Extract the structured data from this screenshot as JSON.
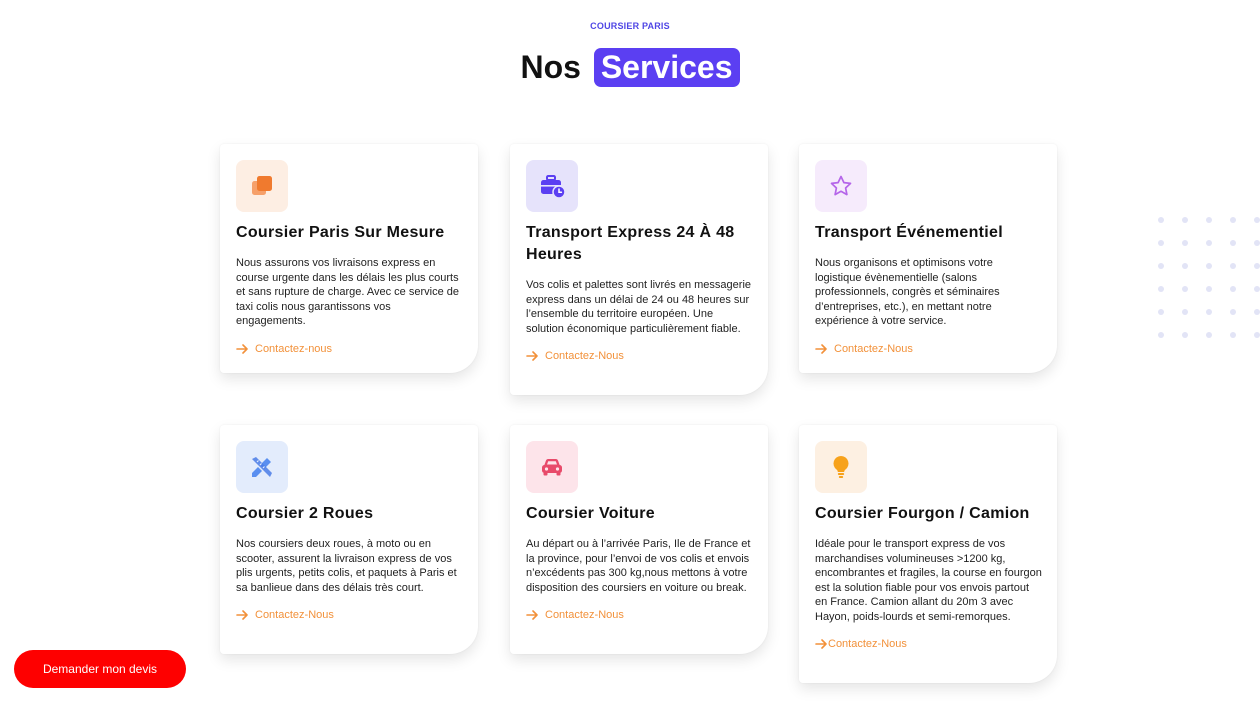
{
  "header": {
    "eyebrow": "COURSIER PARIS",
    "title_plain": "Nos",
    "title_highlight": "Services"
  },
  "colors": {
    "accent": "#5b3ff2",
    "link": "#f2913a",
    "cta_button": "#fe0000"
  },
  "services": [
    {
      "icon": "copy-icon",
      "title": "Coursier Paris Sur Mesure",
      "description": "Nous assurons vos livraisons express en course urgente dans les délais les plus courts et sans rupture de charge. Avec ce service de taxi colis nous garantissons vos engagements.",
      "link": "Contactez-nous"
    },
    {
      "icon": "briefcase-clock-icon",
      "title": "Transport Express 24 À 48 Heures",
      "description": "Vos colis et palettes sont livrés en messagerie express dans un délai de 24 ou 48 heures sur l’ensemble du territoire européen. Une solution économique particulièrement fiable.",
      "link": "Contactez-Nous"
    },
    {
      "icon": "star-icon",
      "title": "Transport Événementiel",
      "description": "Nous organisons et optimisons votre logistique évènementielle (salons professionnels, congrès et séminaires d’entreprises, etc.), en mettant notre expérience à votre service.",
      "link": "Contactez-Nous"
    },
    {
      "icon": "pencil-ruler-icon",
      "title": "Coursier 2 Roues",
      "description": "Nos coursiers deux roues, à moto ou en scooter, assurent la livraison express de vos plis urgents, petits colis, et paquets à Paris et sa banlieue dans des délais très court.",
      "link": "Contactez-Nous"
    },
    {
      "icon": "car-icon",
      "title": "Coursier Voiture",
      "description": "Au départ ou à l’arrivée Paris, Ile de France et la province, pour l’envoi de vos colis et envois n’excédents pas 300 kg,nous mettons à votre disposition des coursiers en voiture ou break.",
      "link": "Contactez-Nous"
    },
    {
      "icon": "lightbulb-icon",
      "title": "Coursier Fourgon / Camion",
      "description": "Idéale pour le transport express de vos marchandises volumineuses >1200 kg, encombrantes et fragiles, la course en fourgon est la solution fiable pour vos envois partout en France. Camion allant du 20m 3 avec Hayon, poids-lourds et semi-remorques.",
      "link": "Contactez-Nous"
    }
  ],
  "cta_button": {
    "label": "Demander mon devis"
  }
}
